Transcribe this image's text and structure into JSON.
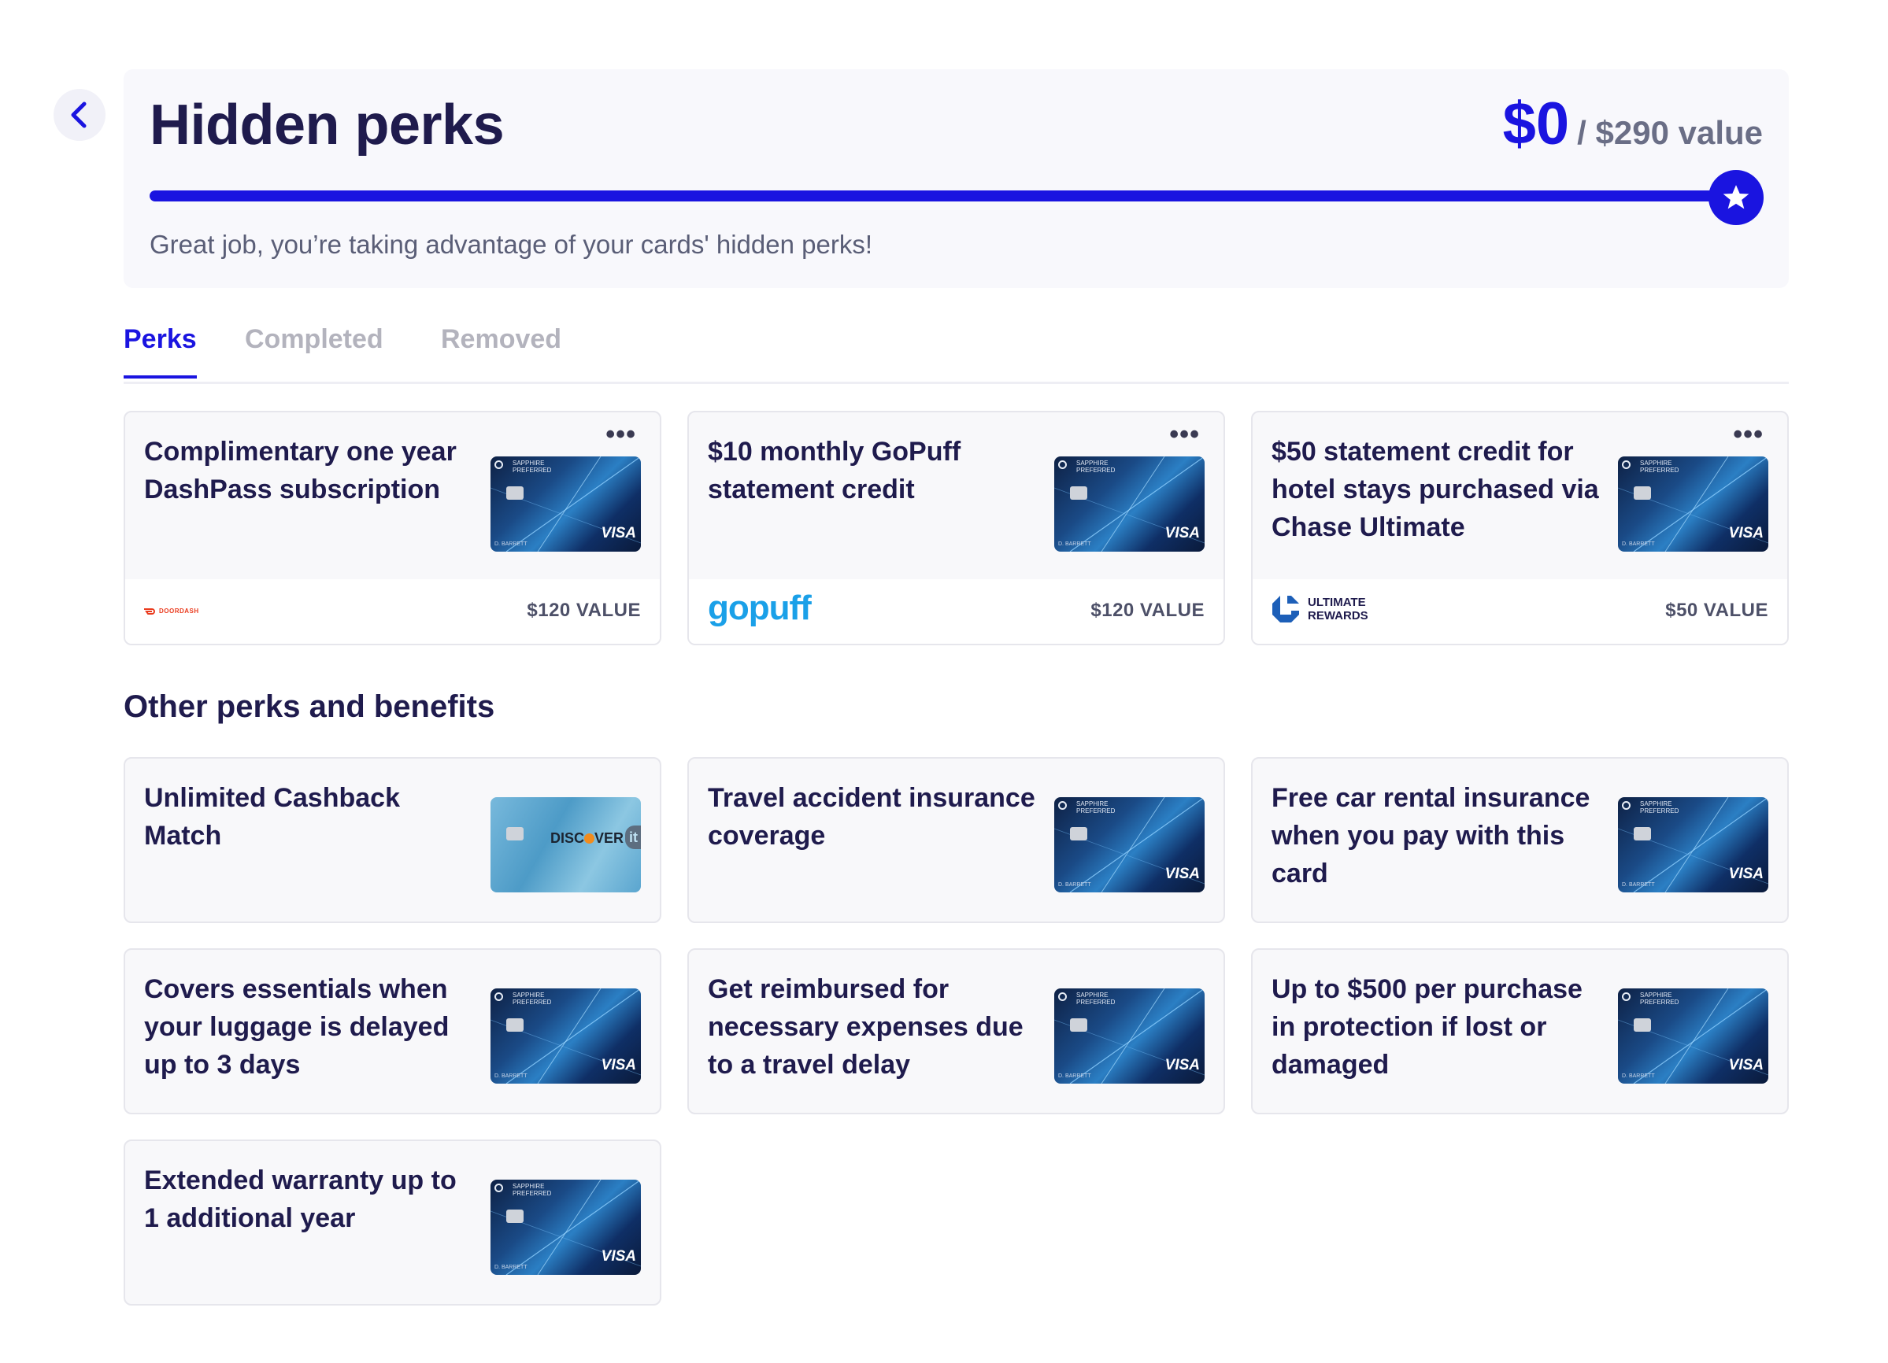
{
  "header": {
    "title": "Hidden perks",
    "current_value": "$0",
    "total_value": "/ $290 value",
    "progress_fraction": 1.0,
    "subtitle": "Great job, you’re taking advantage of your cards' hidden perks!"
  },
  "tabs": [
    {
      "label": "Perks",
      "active": true
    },
    {
      "label": "Completed",
      "active": false
    },
    {
      "label": "Removed",
      "active": false
    }
  ],
  "perks": [
    {
      "title": "Complimentary one year DashPass subscription",
      "value": "$120 VALUE",
      "brand": "doordash",
      "brand_label": "DOORDASH",
      "card": "chase-sapphire"
    },
    {
      "title": "$10 monthly GoPuff statement credit",
      "value": "$120 VALUE",
      "brand": "gopuff",
      "brand_label": "gopuff",
      "card": "chase-sapphire"
    },
    {
      "title": "$50 statement credit for hotel stays purchased via Chase Ultimate",
      "value": "$50 VALUE",
      "brand": "ultimate-rewards",
      "brand_label_1": "ULTIMATE",
      "brand_label_2": "REWARDS",
      "card": "chase-sapphire"
    }
  ],
  "other_section_title": "Other perks and benefits",
  "other_perks": [
    {
      "title": "Unlimited Cashback Match",
      "card": "discover-it"
    },
    {
      "title": "Travel accident insurance coverage",
      "card": "chase-sapphire"
    },
    {
      "title": "Free car rental insurance when you pay with this card",
      "card": "chase-sapphire"
    },
    {
      "title": "Covers essentials when your luggage is delayed up to 3 days",
      "card": "chase-sapphire"
    },
    {
      "title": "Get reimbursed for necessary expenses due to a travel delay",
      "card": "chase-sapphire"
    },
    {
      "title": "Up to $500 per purchase in protection if lost or damaged",
      "card": "chase-sapphire"
    },
    {
      "title": "Extended warranty up to 1 additional year",
      "card": "chase-sapphire"
    }
  ],
  "card_art": {
    "chase": {
      "brand_line_1": "SAPPHIRE",
      "brand_line_2": "PREFERRED",
      "network": "VISA",
      "holder": "D. BARRETT"
    },
    "discover": {
      "label_left": "DISC",
      "label_right": "VER",
      "badge": "it"
    }
  },
  "menu_glyph": "•••",
  "colors": {
    "accent": "#1a14e0",
    "text": "#1f1b4d",
    "muted": "#6a6e86"
  }
}
